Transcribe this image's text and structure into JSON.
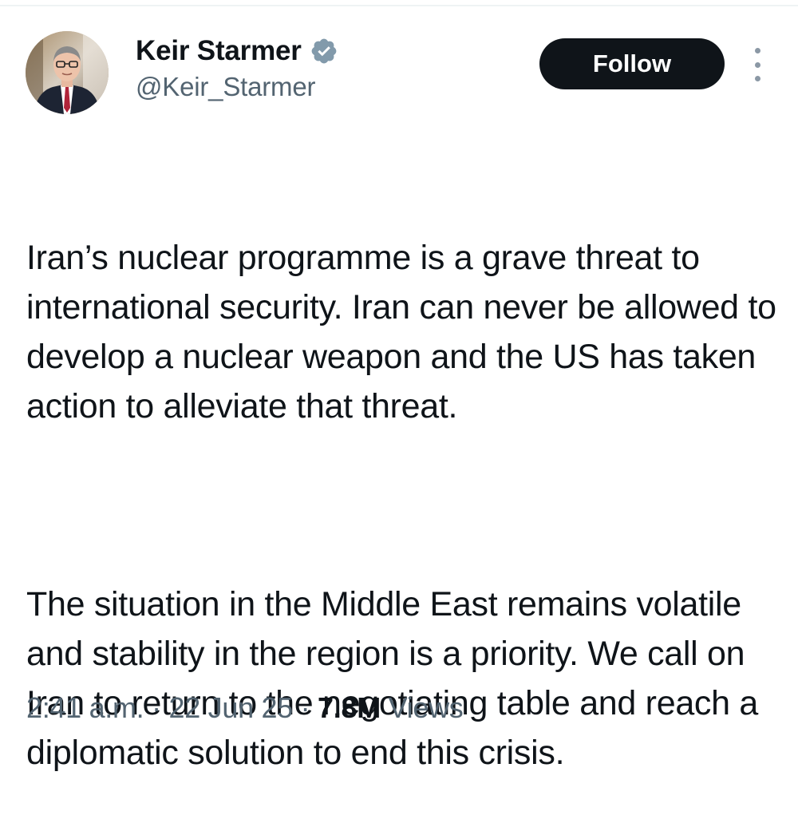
{
  "author": {
    "display_name": "Keir Starmer",
    "handle": "@Keir_Starmer",
    "verified": true
  },
  "actions": {
    "follow_label": "Follow"
  },
  "tweet": {
    "paragraphs": [
      "Iran’s nuclear programme is a grave threat to international security. Iran can never be allowed to develop a nuclear weapon and the US has taken action to alleviate that threat.",
      "The situation in the Middle East remains volatile and stability in the region is a priority. We call on Iran to return to the negotiating table and reach a diplomatic solution to end this crisis."
    ]
  },
  "meta": {
    "time": "2:41 a.m.",
    "separator": "·",
    "date": "22 Jun 25",
    "views_count": "7.8M",
    "views_label": "Views"
  },
  "colors": {
    "text_primary": "#0f1419",
    "text_secondary": "#536471",
    "follow_bg": "#0f1419",
    "verified_badge": "#829aab"
  },
  "icons": {
    "verified": "verified-badge-icon",
    "more": "more-options-icon"
  }
}
